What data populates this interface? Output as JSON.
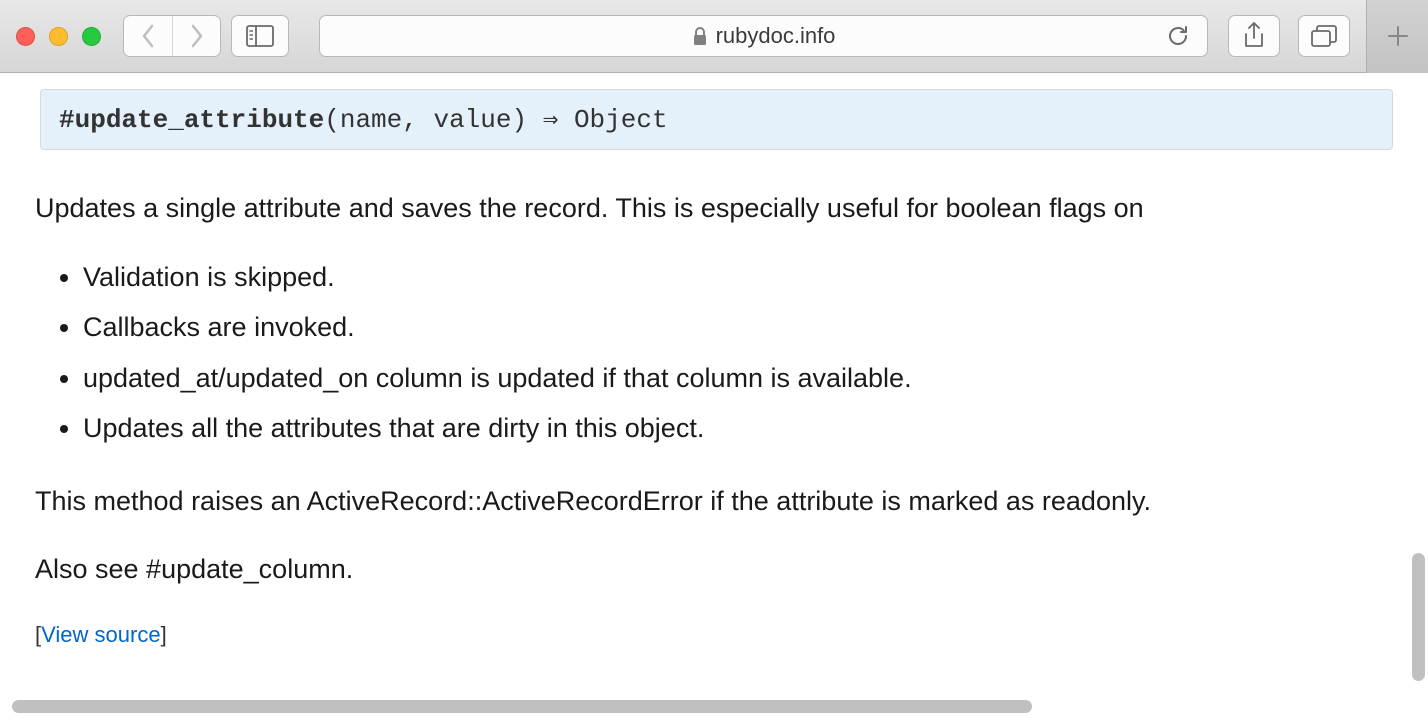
{
  "browser": {
    "url_domain": "rubydoc.info"
  },
  "method": {
    "prefix": "#",
    "name": "update_attribute",
    "params": "(name, value)",
    "arrow": " ⇒ ",
    "return_type": "Object"
  },
  "doc": {
    "intro": "Updates a single attribute and saves the record. This is especially useful for boolean flags on",
    "list_items": [
      "Validation is skipped.",
      "Callbacks are invoked.",
      "updated_at/updated_on column is updated if that column is available.",
      "Updates all the attributes that are dirty in this object."
    ],
    "error_note": "This method raises an ActiveRecord::ActiveRecordError if the attribute is marked as readonly.",
    "see_also": "Also see #update_column.",
    "view_source_open": "[",
    "view_source_label": "View source",
    "view_source_close": "]"
  }
}
